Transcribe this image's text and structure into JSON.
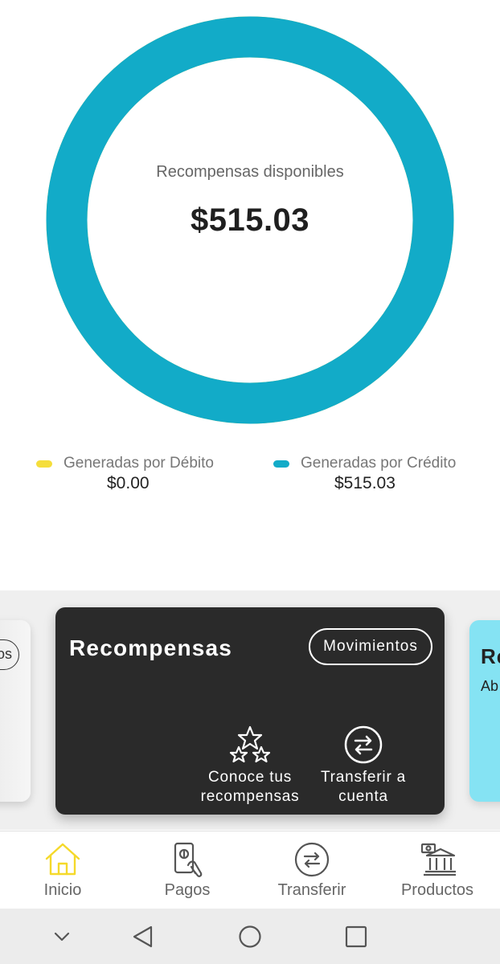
{
  "rewards": {
    "available_label": "Recompensas disponibles",
    "available_amount": "$515.03",
    "debit_fraction": 0.0,
    "credit_fraction": 1.0
  },
  "legend": [
    {
      "name": "Generadas por Débito",
      "value": "$0.00",
      "color": "#f5de3b"
    },
    {
      "name": "Generadas por Crédito",
      "value": "$515.03",
      "color": "#12abc8"
    }
  ],
  "carousel": {
    "left_card_pill": "os",
    "main_card": {
      "title": "Recompensas",
      "pill_label": "Movimientos",
      "actions": [
        {
          "label": "Conoce tus\nrecompensas",
          "icon": "stars-icon"
        },
        {
          "label": "Transferir a\ncuenta",
          "icon": "transfer-arrows-icon"
        }
      ]
    },
    "right_card": {
      "title": "Re",
      "subtitle": "Ab"
    }
  },
  "bottom_nav": [
    {
      "label": "Inicio",
      "icon": "home-icon",
      "active": true
    },
    {
      "label": "Pagos",
      "icon": "phone-pay-icon",
      "active": false
    },
    {
      "label": "Transferir",
      "icon": "transfer-icon",
      "active": false
    },
    {
      "label": "Productos",
      "icon": "bank-icon",
      "active": false
    }
  ],
  "colors": {
    "accent_yellow": "#f5de3b",
    "donut_teal": "#12abc8",
    "card_dark": "#2a2a2a",
    "card_cyan": "#85e3f3"
  }
}
